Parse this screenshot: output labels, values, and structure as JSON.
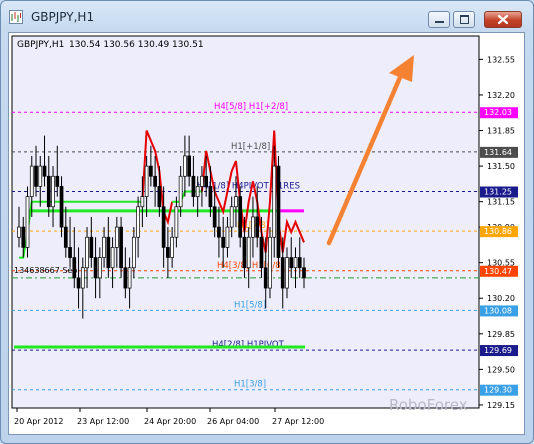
{
  "window": {
    "title": "GBPJPY,H1"
  },
  "chart_info": {
    "symbol_tf": "GBPJPY,H1",
    "ohlc": "130.54 130.56 130.49 130.51"
  },
  "watermark": "RoboForex",
  "colors": {
    "plot_bg": "#ededfc",
    "grid": "#000000",
    "green": "#21e821",
    "red": "#e60000",
    "candles": "#000000",
    "arrow": "#f58232"
  },
  "chart_data": {
    "type": "candlestick",
    "title": "GBPJPY,H1",
    "ylim": [
      129.12,
      132.78
    ],
    "y_ticks": [
      "132.55",
      "132.20",
      "131.85",
      "131.50",
      "131.15",
      "130.90",
      "130.55",
      "130.20",
      "129.85",
      "129.50",
      "129.15"
    ],
    "x_tick_labels": [
      "20 Apr 2012",
      "23 Apr 12:00",
      "24 Apr 20:00",
      "26 Apr 04:00",
      "27 Apr 12:00"
    ],
    "levels": [
      {
        "label": "H4[5/8] H1[+2/8]",
        "price": 132.03,
        "color": "#ff00ff",
        "badge": "132.03"
      },
      {
        "label": "H1[+1/8]",
        "price": 131.64,
        "color": "#4d4d4d",
        "badge": "131.64"
      },
      {
        "label": "H4[1/8] H4PIVOT H1RES",
        "price": 131.25,
        "color": "#1a1a8c",
        "badge": "131.25"
      },
      {
        "label": "H1[7/8]",
        "price": 130.86,
        "color": "#ffa500",
        "badge": "130.86"
      },
      {
        "label": "H4[3/8] H1[6/8]",
        "price": 130.47,
        "color": "#ff4500",
        "badge": "130.47"
      },
      {
        "label": "H1[5/8]",
        "price": 130.08,
        "color": "#3aa0e6",
        "badge": "130.08"
      },
      {
        "label": "H4[2/8] H1PIVOT",
        "price": 129.69,
        "color": "#1a1a8c",
        "badge": "129.69"
      },
      {
        "label": "H1[3/8]",
        "price": 129.3,
        "color": "#3aa0e6",
        "badge": "129.30"
      }
    ],
    "extra_labels": [
      {
        "text": "134638667 Sep",
        "price": 130.45
      }
    ],
    "pivot_lines": [
      {
        "name": "H4 pivot",
        "price": 131.06
      },
      {
        "name": "H1 pivot",
        "price": 129.72
      }
    ],
    "current_price": 130.4,
    "candles": [
      [
        130.8,
        131.1,
        130.7,
        130.9
      ],
      [
        130.9,
        131.0,
        130.6,
        130.7
      ],
      [
        130.7,
        131.3,
        130.6,
        131.2
      ],
      [
        131.2,
        131.6,
        131.0,
        131.5
      ],
      [
        131.5,
        131.7,
        131.2,
        131.3
      ],
      [
        131.3,
        131.6,
        131.1,
        131.5
      ],
      [
        131.5,
        131.8,
        131.3,
        131.4
      ],
      [
        131.4,
        131.6,
        131.0,
        131.1
      ],
      [
        131.1,
        131.5,
        130.9,
        131.4
      ],
      [
        131.4,
        131.7,
        131.2,
        131.3
      ],
      [
        131.3,
        131.4,
        130.8,
        130.9
      ],
      [
        130.9,
        131.1,
        130.6,
        130.7
      ],
      [
        130.7,
        131.0,
        130.5,
        130.6
      ],
      [
        130.6,
        130.9,
        130.3,
        130.4
      ],
      [
        130.4,
        130.7,
        130.1,
        130.3
      ],
      [
        130.3,
        130.6,
        130.0,
        130.5
      ],
      [
        130.5,
        130.9,
        130.3,
        130.8
      ],
      [
        130.8,
        131.0,
        130.5,
        130.6
      ],
      [
        130.6,
        130.8,
        130.2,
        130.4
      ],
      [
        130.4,
        130.7,
        130.2,
        130.6
      ],
      [
        130.6,
        130.9,
        130.5,
        130.8
      ],
      [
        130.8,
        131.0,
        130.4,
        130.5
      ],
      [
        130.5,
        130.8,
        130.3,
        130.7
      ],
      [
        130.7,
        131.0,
        130.5,
        130.9
      ],
      [
        130.9,
        131.0,
        130.4,
        130.5
      ],
      [
        130.5,
        130.7,
        130.2,
        130.3
      ],
      [
        130.3,
        130.6,
        130.1,
        130.5
      ],
      [
        130.5,
        130.9,
        130.4,
        130.8
      ],
      [
        130.8,
        131.2,
        130.6,
        131.1
      ],
      [
        131.1,
        131.4,
        130.9,
        131.2
      ],
      [
        131.2,
        131.6,
        131.0,
        131.5
      ],
      [
        131.5,
        131.7,
        131.3,
        131.4
      ],
      [
        131.4,
        131.6,
        131.1,
        131.3
      ],
      [
        131.3,
        131.5,
        131.0,
        131.1
      ],
      [
        131.1,
        131.3,
        130.5,
        130.7
      ],
      [
        130.7,
        130.9,
        130.4,
        130.6
      ],
      [
        130.6,
        130.9,
        130.5,
        130.8
      ],
      [
        130.8,
        131.2,
        130.7,
        131.1
      ],
      [
        131.1,
        131.5,
        131.0,
        131.4
      ],
      [
        131.4,
        131.8,
        131.2,
        131.6
      ],
      [
        131.6,
        131.8,
        131.3,
        131.4
      ],
      [
        131.4,
        131.6,
        131.1,
        131.2
      ],
      [
        131.2,
        131.4,
        131.0,
        131.3
      ],
      [
        131.3,
        131.5,
        131.1,
        131.4
      ],
      [
        131.4,
        131.6,
        131.2,
        131.3
      ],
      [
        131.3,
        131.5,
        131.0,
        131.1
      ],
      [
        131.1,
        131.3,
        130.8,
        130.9
      ],
      [
        130.9,
        131.1,
        130.6,
        130.8
      ],
      [
        130.8,
        131.0,
        130.5,
        130.7
      ],
      [
        130.7,
        131.0,
        130.6,
        130.9
      ],
      [
        130.9,
        131.2,
        130.8,
        131.1
      ],
      [
        131.1,
        131.4,
        130.9,
        131.2
      ],
      [
        131.2,
        131.3,
        130.7,
        130.8
      ],
      [
        130.8,
        131.0,
        130.4,
        130.5
      ],
      [
        130.5,
        130.9,
        130.3,
        130.8
      ],
      [
        130.8,
        131.2,
        130.6,
        131.0
      ],
      [
        131.0,
        131.3,
        130.7,
        130.8
      ],
      [
        130.8,
        131.0,
        130.4,
        130.5
      ],
      [
        130.5,
        130.8,
        130.1,
        130.3
      ],
      [
        130.3,
        130.9,
        130.2,
        130.8
      ],
      [
        130.8,
        131.7,
        130.6,
        131.5
      ],
      [
        131.5,
        131.6,
        130.5,
        130.6
      ],
      [
        130.6,
        130.8,
        130.1,
        130.3
      ],
      [
        130.3,
        130.7,
        130.2,
        130.6
      ],
      [
        130.6,
        130.8,
        130.4,
        130.5
      ],
      [
        130.5,
        130.7,
        130.3,
        130.6
      ],
      [
        130.6,
        130.8,
        130.4,
        130.5
      ],
      [
        130.5,
        130.6,
        130.3,
        130.4
      ]
    ]
  }
}
